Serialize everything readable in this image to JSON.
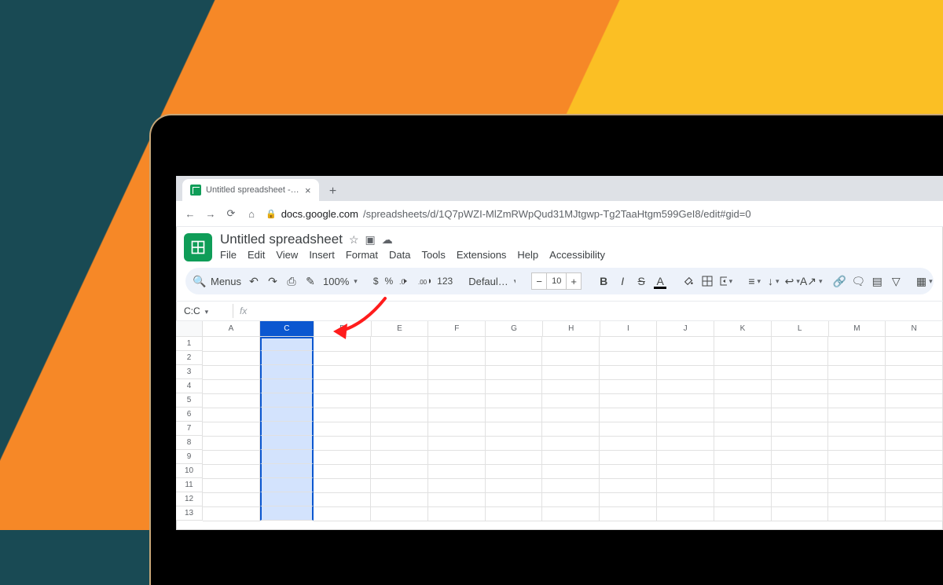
{
  "browser": {
    "tab_title": "Untitled spreadsheet - Google Sh",
    "url_host": "docs.google.com",
    "url_path": "/spreadsheets/d/1Q7pWZI-MlZmRWpQud31MJtgwp-Tg2TaaHtgm599GeI8/edit#gid=0"
  },
  "doc": {
    "title": "Untitled spreadsheet",
    "menus": [
      "File",
      "Edit",
      "View",
      "Insert",
      "Format",
      "Data",
      "Tools",
      "Extensions",
      "Help",
      "Accessibility"
    ]
  },
  "toolbar": {
    "search_label": "Menus",
    "zoom": "100%",
    "dollar": "$",
    "percent": "%",
    "dec_dec": ".0←",
    "inc_dec": ".00→",
    "num_fmt": "123",
    "font_name": "Defaul…",
    "font_size": "10"
  },
  "formula": {
    "namebox": "C:C",
    "fx": "fx"
  },
  "grid": {
    "columns": [
      "A",
      "C",
      "D",
      "E",
      "F",
      "G",
      "H",
      "I",
      "J",
      "K",
      "L",
      "M",
      "N"
    ],
    "selected_column": "C",
    "collapsed_between_A_and_C": true,
    "rows": [
      1,
      2,
      3,
      4,
      5,
      6,
      7,
      8,
      9,
      10,
      11,
      12,
      13
    ]
  }
}
